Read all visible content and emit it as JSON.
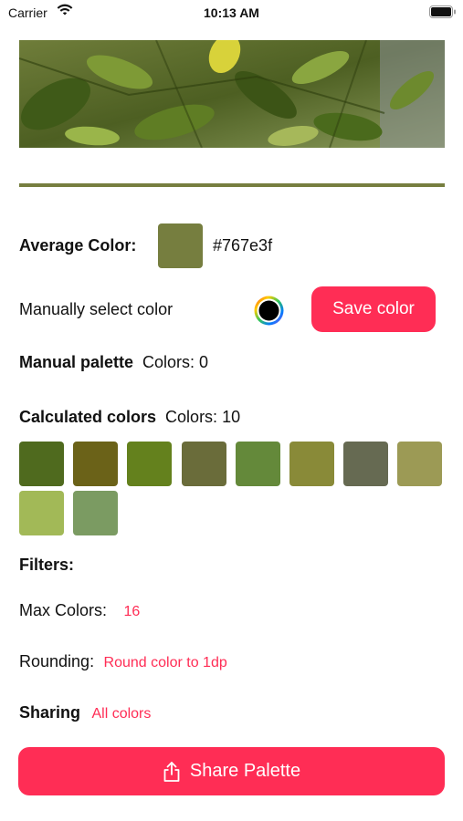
{
  "status_bar": {
    "carrier": "Carrier",
    "time": "10:13 AM"
  },
  "colors": {
    "accent": "#ff2d55",
    "divider": "#767e3f",
    "average": "#767e3f"
  },
  "average_color": {
    "label": "Average Color:",
    "hex": "#767e3f"
  },
  "manual_select": {
    "label": "Manually select color",
    "save_label": "Save color"
  },
  "manual_palette": {
    "label": "Manual palette",
    "count_text": "Colors: 0"
  },
  "calculated": {
    "label": "Calculated colors",
    "count_text": "Colors: 10",
    "swatches": [
      "#4f6a1e",
      "#6b6218",
      "#64811d",
      "#6a6c3a",
      "#64893a",
      "#898a38",
      "#666a52",
      "#9c9a55",
      "#a2b957",
      "#7b9b62"
    ]
  },
  "filters": {
    "label": "Filters:",
    "max_colors_label": "Max Colors:",
    "max_colors_value": "16",
    "rounding_label": "Rounding:",
    "rounding_value": "Round color to 1dp",
    "sharing_label": "Sharing",
    "sharing_value": "All colors"
  },
  "share": {
    "button_label": "Share Palette",
    "icon": "share-icon"
  }
}
